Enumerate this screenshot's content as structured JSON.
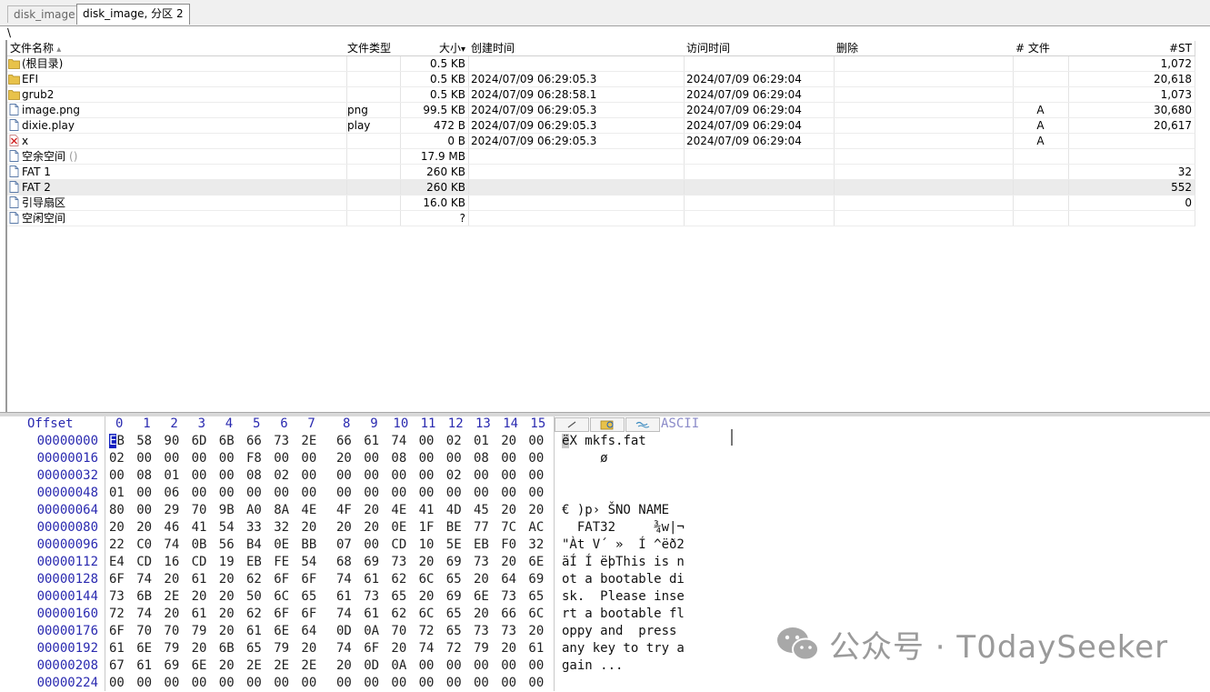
{
  "tabs": [
    {
      "label": "disk_image"
    },
    {
      "label": "disk_image, 分区 2"
    }
  ],
  "path": "\\",
  "columns": [
    {
      "label": "文件名称"
    },
    {
      "label": "文件类型"
    },
    {
      "label": "大小"
    },
    {
      "label": "创建时间"
    },
    {
      "label": "访问时间"
    },
    {
      "label": "删除"
    },
    {
      "label": "# 文件"
    },
    {
      "label": "#ST"
    }
  ],
  "rows": [
    {
      "name": "(根目录)",
      "type": "",
      "size": "0.5 KB",
      "created": "",
      "accessed": "",
      "deleted": "",
      "attr": "",
      "st": "1,072",
      "icon": "folder"
    },
    {
      "name": "EFI",
      "type": "",
      "size": "0.5 KB",
      "created": "2024/07/09  06:29:05.3",
      "accessed": "2024/07/09  06:29:04",
      "deleted": "",
      "attr": "",
      "st": "20,618",
      "icon": "folder"
    },
    {
      "name": "grub2",
      "type": "",
      "size": "0.5 KB",
      "created": "2024/07/09  06:28:58.1",
      "accessed": "2024/07/09  06:29:04",
      "deleted": "",
      "attr": "",
      "st": "1,073",
      "icon": "folder"
    },
    {
      "name": "image.png",
      "type": "png",
      "size": "99.5 KB",
      "created": "2024/07/09  06:29:05.3",
      "accessed": "2024/07/09  06:29:04",
      "deleted": "",
      "attr": "A",
      "st": "30,680",
      "icon": "file"
    },
    {
      "name": "dixie.play",
      "type": "play",
      "size": "472 B",
      "created": "2024/07/09  06:29:05.3",
      "accessed": "2024/07/09  06:29:04",
      "deleted": "",
      "attr": "A",
      "st": "20,617",
      "icon": "file"
    },
    {
      "name": "x",
      "type": "",
      "size": "0 B",
      "created": "2024/07/09  06:29:05.3",
      "accessed": "2024/07/09  06:29:04",
      "deleted": "",
      "attr": "A",
      "st": "",
      "icon": "deleted"
    },
    {
      "name": "空余空间",
      "name_extra": "()",
      "type": "",
      "size": "17.9 MB",
      "created": "",
      "accessed": "",
      "deleted": "",
      "attr": "",
      "st": "",
      "icon": "file"
    },
    {
      "name": "FAT 1",
      "type": "",
      "size": "260 KB",
      "created": "",
      "accessed": "",
      "deleted": "",
      "attr": "",
      "st": "32",
      "icon": "file"
    },
    {
      "name": "FAT 2",
      "type": "",
      "size": "260 KB",
      "created": "",
      "accessed": "",
      "deleted": "",
      "attr": "",
      "st": "552",
      "icon": "file",
      "selected": true
    },
    {
      "name": "引导扇区",
      "type": "",
      "size": "16.0 KB",
      "created": "",
      "accessed": "",
      "deleted": "",
      "attr": "",
      "st": "0",
      "icon": "file"
    },
    {
      "name": "空闲空间",
      "type": "",
      "size": "?",
      "created": "",
      "accessed": "",
      "deleted": "",
      "attr": "",
      "st": "",
      "icon": "file"
    }
  ],
  "hex": {
    "offset_label": "Offset",
    "col_labels": [
      "0",
      "1",
      "2",
      "3",
      "4",
      "5",
      "6",
      "7",
      "8",
      "9",
      "10",
      "11",
      "12",
      "13",
      "14",
      "15"
    ],
    "ascii_label": "ASCII",
    "rows": [
      {
        "offset": "00000000",
        "bytes": [
          "EB",
          "58",
          "90",
          "6D",
          "6B",
          "66",
          "73",
          "2E",
          "66",
          "61",
          "74",
          "00",
          "02",
          "01",
          "20",
          "00"
        ],
        "ascii": "ëX mkfs.fat"
      },
      {
        "offset": "00000016",
        "bytes": [
          "02",
          "00",
          "00",
          "00",
          "00",
          "F8",
          "00",
          "00",
          "20",
          "00",
          "08",
          "00",
          "00",
          "08",
          "00",
          "00"
        ],
        "ascii": "     ø"
      },
      {
        "offset": "00000032",
        "bytes": [
          "00",
          "08",
          "01",
          "00",
          "00",
          "08",
          "02",
          "00",
          "00",
          "00",
          "00",
          "00",
          "02",
          "00",
          "00",
          "00"
        ],
        "ascii": ""
      },
      {
        "offset": "00000048",
        "bytes": [
          "01",
          "00",
          "06",
          "00",
          "00",
          "00",
          "00",
          "00",
          "00",
          "00",
          "00",
          "00",
          "00",
          "00",
          "00",
          "00"
        ],
        "ascii": ""
      },
      {
        "offset": "00000064",
        "bytes": [
          "80",
          "00",
          "29",
          "70",
          "9B",
          "A0",
          "8A",
          "4E",
          "4F",
          "20",
          "4E",
          "41",
          "4D",
          "45",
          "20",
          "20"
        ],
        "ascii": "€ )p› ŠNO NAME"
      },
      {
        "offset": "00000080",
        "bytes": [
          "20",
          "20",
          "46",
          "41",
          "54",
          "33",
          "32",
          "20",
          "20",
          "20",
          "0E",
          "1F",
          "BE",
          "77",
          "7C",
          "AC"
        ],
        "ascii": "  FAT32     ¾w|¬"
      },
      {
        "offset": "00000096",
        "bytes": [
          "22",
          "C0",
          "74",
          "0B",
          "56",
          "B4",
          "0E",
          "BB",
          "07",
          "00",
          "CD",
          "10",
          "5E",
          "EB",
          "F0",
          "32"
        ],
        "ascii": "\"Àt V´ »  Í ^ëð2"
      },
      {
        "offset": "00000112",
        "bytes": [
          "E4",
          "CD",
          "16",
          "CD",
          "19",
          "EB",
          "FE",
          "54",
          "68",
          "69",
          "73",
          "20",
          "69",
          "73",
          "20",
          "6E"
        ],
        "ascii": "äÍ Í ëþThis is n"
      },
      {
        "offset": "00000128",
        "bytes": [
          "6F",
          "74",
          "20",
          "61",
          "20",
          "62",
          "6F",
          "6F",
          "74",
          "61",
          "62",
          "6C",
          "65",
          "20",
          "64",
          "69"
        ],
        "ascii": "ot a bootable di"
      },
      {
        "offset": "00000144",
        "bytes": [
          "73",
          "6B",
          "2E",
          "20",
          "20",
          "50",
          "6C",
          "65",
          "61",
          "73",
          "65",
          "20",
          "69",
          "6E",
          "73",
          "65"
        ],
        "ascii": "sk.  Please inse"
      },
      {
        "offset": "00000160",
        "bytes": [
          "72",
          "74",
          "20",
          "61",
          "20",
          "62",
          "6F",
          "6F",
          "74",
          "61",
          "62",
          "6C",
          "65",
          "20",
          "66",
          "6C"
        ],
        "ascii": "rt a bootable fl"
      },
      {
        "offset": "00000176",
        "bytes": [
          "6F",
          "70",
          "70",
          "79",
          "20",
          "61",
          "6E",
          "64",
          "0D",
          "0A",
          "70",
          "72",
          "65",
          "73",
          "73",
          "20"
        ],
        "ascii": "oppy and  press "
      },
      {
        "offset": "00000192",
        "bytes": [
          "61",
          "6E",
          "79",
          "20",
          "6B",
          "65",
          "79",
          "20",
          "74",
          "6F",
          "20",
          "74",
          "72",
          "79",
          "20",
          "61"
        ],
        "ascii": "any key to try a"
      },
      {
        "offset": "00000208",
        "bytes": [
          "67",
          "61",
          "69",
          "6E",
          "20",
          "2E",
          "2E",
          "2E",
          "20",
          "0D",
          "0A",
          "00",
          "00",
          "00",
          "00",
          "00"
        ],
        "ascii": "gain ..."
      },
      {
        "offset": "00000224",
        "bytes": [
          "00",
          "00",
          "00",
          "00",
          "00",
          "00",
          "00",
          "00",
          "00",
          "00",
          "00",
          "00",
          "00",
          "00",
          "00",
          "00"
        ],
        "ascii": ""
      }
    ]
  },
  "watermark": "公众号 · T0daySeeker",
  "colors": {
    "offset_blue": "#2a2ab0",
    "cursor": "#1020c0",
    "folder": "#e8c24a"
  }
}
